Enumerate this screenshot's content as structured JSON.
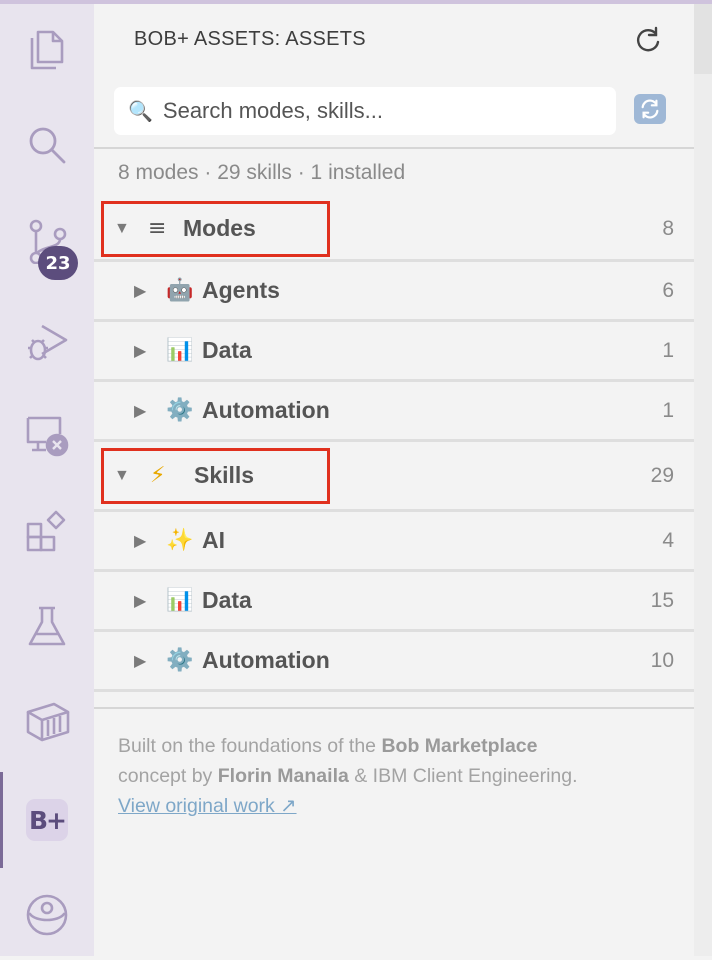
{
  "activity_bar": {
    "items": [
      {
        "name": "explorer-icon"
      },
      {
        "name": "search-icon"
      },
      {
        "name": "source-control-icon",
        "badge": "23"
      },
      {
        "name": "run-debug-icon"
      },
      {
        "name": "remote-explorer-icon"
      },
      {
        "name": "extensions-icon"
      },
      {
        "name": "testing-icon"
      },
      {
        "name": "containers-icon"
      },
      {
        "name": "bob-plus-icon",
        "label": "B+",
        "active": true
      },
      {
        "name": "accounts-sync-icon"
      }
    ]
  },
  "panel": {
    "title": "BOB+ ASSETS: ASSETS",
    "search_placeholder": "Search modes, skills...",
    "summary": "8 modes · 29 skills · 1 installed",
    "modes": {
      "arrow": "▼",
      "icon": "≡",
      "label": "Modes",
      "count": "8",
      "items": [
        {
          "arrow": "▶",
          "icon": "🤖",
          "label": "Agents",
          "count": "6"
        },
        {
          "arrow": "▶",
          "icon": "📊",
          "label": "Data",
          "count": "1"
        },
        {
          "arrow": "▶",
          "icon": "⚙️",
          "label": "Automation",
          "count": "1"
        }
      ]
    },
    "skills": {
      "arrow": "▼",
      "icon": "⚡",
      "label": "Skills",
      "count": "29",
      "items": [
        {
          "arrow": "▶",
          "icon": "✨",
          "label": "AI",
          "count": "4"
        },
        {
          "arrow": "▶",
          "icon": "📊",
          "label": "Data",
          "count": "15"
        },
        {
          "arrow": "▶",
          "icon": "⚙️",
          "label": "Automation",
          "count": "10"
        }
      ]
    },
    "footer": {
      "text1": "Built on the foundations of the ",
      "bold1": "Bob Marketplace",
      "text2": "concept by ",
      "bold2": "Florin Manaila",
      "text3": " & IBM Client Engineering.",
      "link": "View original work ↗"
    }
  },
  "colors": {
    "activity_bg": "#e8e4ee",
    "panel_bg": "#f3f3f3",
    "accent": "#5c4d7d",
    "highlight": "#e0301e",
    "link": "#7ea7c8"
  }
}
